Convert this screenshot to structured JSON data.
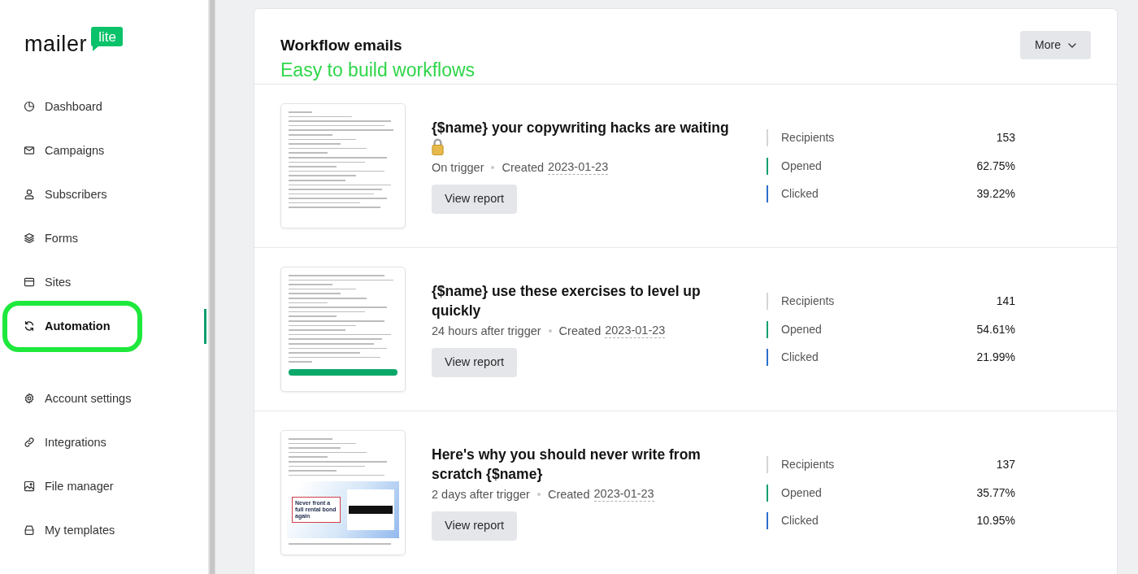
{
  "sidebar": {
    "logo": {
      "wordmark": "mailer",
      "badge": "lite"
    },
    "sections": [
      {
        "items": [
          {
            "label": "Dashboard",
            "selected": false,
            "highlighted": false
          },
          {
            "label": "Campaigns",
            "selected": false,
            "highlighted": false
          },
          {
            "label": "Subscribers",
            "selected": false,
            "highlighted": false
          },
          {
            "label": "Forms",
            "selected": false,
            "highlighted": false
          },
          {
            "label": "Sites",
            "selected": false,
            "highlighted": false
          },
          {
            "label": "Automation",
            "selected": true,
            "highlighted": true
          }
        ]
      },
      {
        "items": [
          {
            "label": "Account settings",
            "selected": false,
            "highlighted": false
          },
          {
            "label": "Integrations",
            "selected": false,
            "highlighted": false
          },
          {
            "label": "File manager",
            "selected": false,
            "highlighted": false
          },
          {
            "label": "My templates",
            "selected": false,
            "highlighted": false
          }
        ]
      }
    ]
  },
  "header": {
    "title": "Workflow emails",
    "annotation": "Easy to build workflows",
    "more_button": "More"
  },
  "emails": [
    {
      "preview": {
        "kind": "text"
      },
      "subject": "{$name} your copywriting hacks are waiting",
      "lock_icon": true,
      "trigger": "On trigger",
      "created_label": "Created",
      "created_date": "2023-01-23",
      "report_button": "View report",
      "stats": [
        {
          "label": "Recipients",
          "value": "153",
          "color": "#d6d6d6"
        },
        {
          "label": "Opened",
          "value": "62.75%",
          "color": "#0e9f6e"
        },
        {
          "label": "Clicked",
          "value": "39.22%",
          "color": "#2c6ecb"
        }
      ]
    },
    {
      "preview": {
        "kind": "text_with_button"
      },
      "subject": "{$name} use these exercises to level up quickly",
      "lock_icon": false,
      "trigger": "24 hours after trigger",
      "created_label": "Created",
      "created_date": "2023-01-23",
      "report_button": "View report",
      "stats": [
        {
          "label": "Recipients",
          "value": "141",
          "color": "#d6d6d6"
        },
        {
          "label": "Opened",
          "value": "54.61%",
          "color": "#0e9f6e"
        },
        {
          "label": "Clicked",
          "value": "21.99%",
          "color": "#2c6ecb"
        }
      ]
    },
    {
      "preview": {
        "kind": "text_with_banner",
        "headline": "Never front a full rental bond again"
      },
      "subject": "Here's why you should never write from scratch {$name}",
      "lock_icon": false,
      "trigger": "2 days after trigger",
      "created_label": "Created",
      "created_date": "2023-01-23",
      "report_button": "View report",
      "stats": [
        {
          "label": "Recipients",
          "value": "137",
          "color": "#d6d6d6"
        },
        {
          "label": "Opened",
          "value": "35.77%",
          "color": "#0e9f6e"
        },
        {
          "label": "Clicked",
          "value": "10.95%",
          "color": "#2c6ecb"
        }
      ]
    }
  ]
}
